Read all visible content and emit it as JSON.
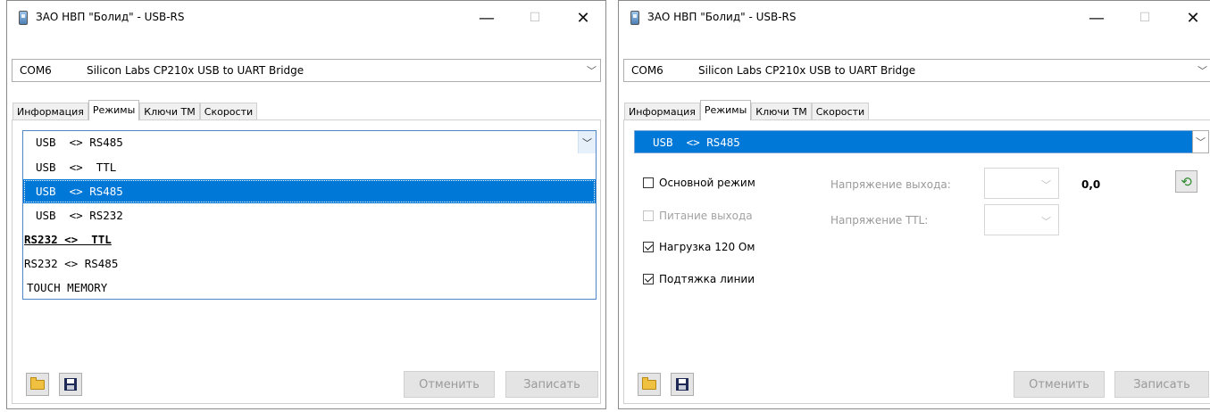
{
  "window_title": "ЗАО НВП \"Болид\" - USB-RS",
  "titlebar": {
    "minimize": "—",
    "maximize": "☐",
    "close": "✕"
  },
  "port": {
    "com": "COM6",
    "description": "Silicon Labs CP210x USB to UART Bridge"
  },
  "tabs": [
    "Информация",
    "Режимы",
    "Ключи ТМ",
    "Скорости"
  ],
  "active_tab": "Режимы",
  "mode": {
    "selected": "USB  <> RS485"
  },
  "mode_options": [
    "USB  <>  TTL",
    "USB  <> RS485",
    "USB  <> RS232",
    "RS232 <>  TTL",
    "RS232 <> RS485",
    "TOUCH MEMORY"
  ],
  "settings": {
    "main_mode": "Основной режим",
    "output_power": "Питание выхода",
    "load_120": "Нагрузка 120 Ом",
    "line_pullup": "Подтяжка линии",
    "output_voltage_label": "Напряжение выхода:",
    "ttl_voltage_label": "Напряжение TTL:",
    "voltage_value": "0,0",
    "checked": {
      "main_mode": false,
      "output_power": false,
      "load_120": true,
      "line_pullup": true
    }
  },
  "buttons": {
    "cancel": "Отменить",
    "write": "Записать"
  },
  "icons": {
    "open": "folder-open-icon",
    "save": "floppy-disk-icon",
    "refresh": "refresh-icon"
  },
  "colors": {
    "selection": "#0078d7",
    "focus_border": "#4f86c8"
  }
}
